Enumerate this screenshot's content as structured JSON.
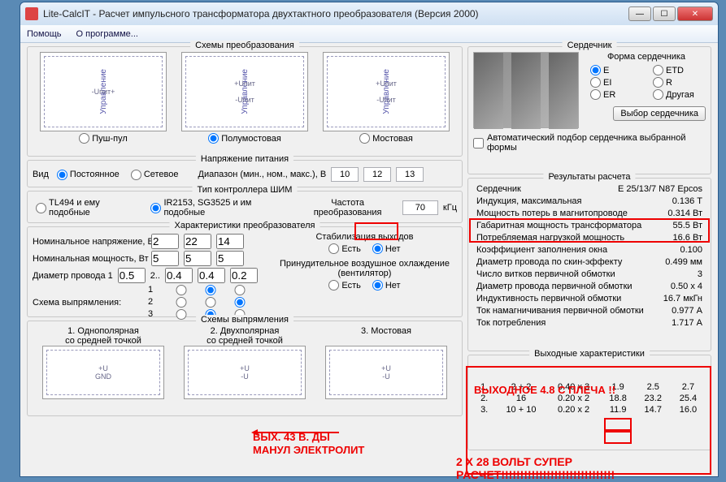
{
  "window": {
    "title": "Lite-CalcIT - Расчет импульсного трансформатора двухтактного преобразователя (Версия 2000)"
  },
  "menu": {
    "help": "Помощь",
    "about": "О программе..."
  },
  "schemes": {
    "title": "Схемы преобразования",
    "pushpull": "Пуш-пул",
    "halfbridge": "Полумостовая",
    "bridge": "Мостовая",
    "upit": "+Uпит",
    "upitneg": "-Uпит",
    "upitpm": "-Uпит+",
    "ctrl": "Управление"
  },
  "power": {
    "title": "Напряжение питания",
    "kind": "Вид",
    "dc": "Постоянное",
    "ac": "Сетевое",
    "range": "Диапазон (мин., ном., макс.), В",
    "min": "10",
    "nom": "12",
    "max": "13"
  },
  "pwm": {
    "title": "Тип контроллера ШИМ",
    "tl494": "TL494 и ему подобные",
    "ir2153": "IR2153, SG3525 и им подобные",
    "freq_lbl": "Частота преобразования",
    "freq": "70",
    "freq_unit": "кГц"
  },
  "conv": {
    "title": "Характеристики преобразователя",
    "nom_v": "Номинальное напряжение, В",
    "nom_p": "Номинальная мощность, Вт",
    "wire_d": "Диаметр провода  1",
    "wire_sep": "2..",
    "v1": "2",
    "v2": "22",
    "v3": "14",
    "p1": "5",
    "p2": "5",
    "p3": "5",
    "d1": "0.5",
    "d2": "0.4",
    "d3": "0.4",
    "d4": "0.2",
    "rect_scheme": "Схема выпрямления:",
    "stab": "Стабилизация выходов",
    "yes": "Есть",
    "no": "Нет",
    "cooling": "Принудительное воздушное охлаждение (вентилятор)"
  },
  "rect": {
    "title": "Схемы выпрямления",
    "s1a": "1. Однополярная",
    "s1b": "со средней точкой",
    "s2a": "2. Двухполярная",
    "s2b": "со средней точкой",
    "s3": "3. Мостовая",
    "plusU": "+U",
    "minusU": "-U",
    "gnd": "GND"
  },
  "core": {
    "title": "Сердечник",
    "form": "Форма сердечника",
    "E": "E",
    "ETD": "ETD",
    "EI": "EI",
    "R": "R",
    "ER": "ER",
    "Other": "Другая",
    "choose": "Выбор сердечника",
    "auto": "Автоматический подбор сердечника выбранной формы"
  },
  "res": {
    "title": "Результаты расчета",
    "core_lbl": "Сердечник",
    "core_val": "E 25/13/7 N87 Epcos",
    "r1l": "Индукция, максимальная",
    "r1v": "0.136 Т",
    "r2l": "Мощность потерь в магнитопроводе",
    "r2v": "0.314 Вт",
    "r3l": "Габаритная мощность трансформатора",
    "r3v": "55.5 Вт",
    "r4l": "Потребляемая нагрузкой мощность",
    "r4v": "16.6 Вт",
    "r5l": "Коэффициент заполнения окна",
    "r5v": "0.100",
    "r6l": "Диаметр провода по скин-эффекту",
    "r6v": "0.499 мм",
    "r7l": "Число витков первичной обмотки",
    "r7v": "3",
    "r8l": "Диаметр провода первичной обмотки",
    "r8v": "0.50 x 4",
    "r9l": "Индуктивность первичной обмотки",
    "r9v": "16.7 мкГн",
    "r10l": "Ток намагничивания первичной обмотки",
    "r10v": "0.977 А",
    "r11l": "Ток потребления",
    "r11v": "1.717 А"
  },
  "out": {
    "title": "Выходные характеристики",
    "r1": {
      "n": "1.",
      "turns": "2 + 2",
      "d": "0.40 x 3",
      "a": "1.9",
      "b": "2.5",
      "c": "2.7"
    },
    "r2": {
      "n": "2.",
      "turns": "16",
      "d": "0.20 x 2",
      "a": "18.8",
      "b": "23.2",
      "c": "25.4"
    },
    "r3": {
      "n": "3.",
      "turns": "10 + 10",
      "d": "0.20 x 2",
      "a": "11.9",
      "b": "14.7",
      "c": "16.0"
    }
  },
  "ann": {
    "out48": "ВЫХОДНОЕ 4.8 С ПЛЕЧА !!",
    "v43a": "ВЫХ. 43 В. ДЫ",
    "v43b": "МАНУЛ ЭЛЕКТРОЛИТ",
    "super": "2 Х 28 ВОЛЬТ  СУПЕР РАСЧЕТ!!!!!!!!!!!!!!!!!!!!!!!!!!!!!!"
  }
}
